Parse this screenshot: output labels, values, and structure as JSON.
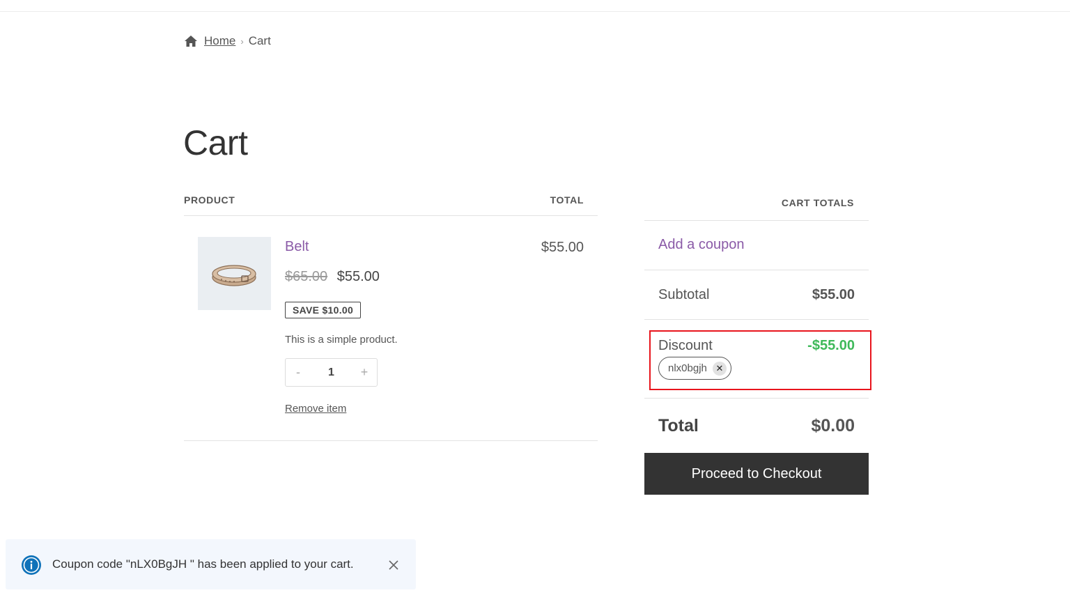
{
  "breadcrumb": {
    "home_label": "Home",
    "current": "Cart"
  },
  "page": {
    "title": "Cart"
  },
  "items_table": {
    "header_product": "PRODUCT",
    "header_total": "TOTAL",
    "rows": [
      {
        "name": "Belt",
        "old_price": "$65.00",
        "price": "$55.00",
        "save_badge": "SAVE $10.00",
        "description": "This is a simple product.",
        "quantity": "1",
        "qty_minus": "-",
        "qty_plus": "+",
        "remove_label": "Remove item",
        "line_total": "$55.00"
      }
    ]
  },
  "totals": {
    "header": "CART TOTALS",
    "add_coupon": "Add a coupon",
    "subtotal_label": "Subtotal",
    "subtotal_value": "$55.00",
    "discount_label": "Discount",
    "discount_value": "-$55.00",
    "coupon_code": "nlx0bgjh",
    "total_label": "Total",
    "total_value": "$0.00",
    "checkout_label": "Proceed to Checkout"
  },
  "notice": {
    "message": "Coupon code \"nLX0BgJH \" has been applied to your cart."
  },
  "colors": {
    "link_purple": "#8a5aa7",
    "discount_green": "#3fb95a",
    "highlight_red": "#e8141c",
    "button_dark": "#333333",
    "notice_blue": "#0f72b9"
  },
  "icons": [
    "home-icon",
    "info-icon",
    "close-icon",
    "remove-coupon-icon",
    "belt-image"
  ]
}
